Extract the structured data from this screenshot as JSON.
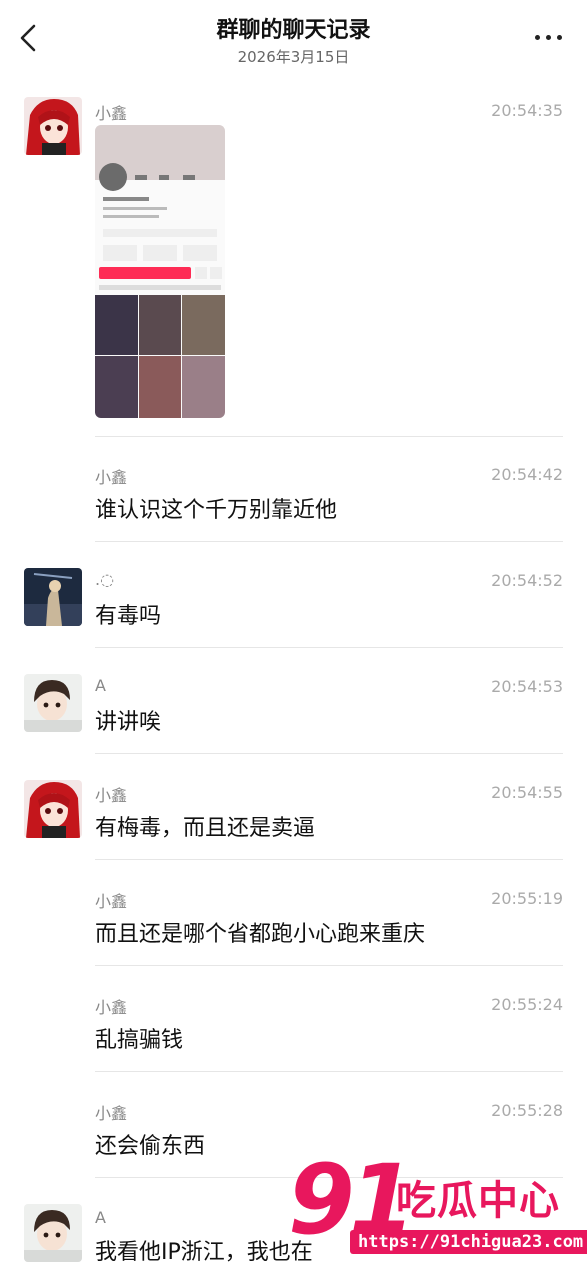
{
  "header": {
    "title": "群聊的聊天记录",
    "date": "2026年3月15日",
    "back_icon": "chevron-left-icon",
    "more_icon": "more-dots-icon"
  },
  "messages": [
    {
      "sender": "小鑫",
      "time": "20:54:35",
      "type": "image",
      "avatar": "red-hair-anime-girl"
    },
    {
      "sender": "小鑫",
      "time": "20:54:42",
      "text": "谁认识这个千万别靠近他"
    },
    {
      "sender": ".◌",
      "time": "20:54:52",
      "text": "有毒吗",
      "avatar": "photo-person-night"
    },
    {
      "sender": "A",
      "time": "20:54:53",
      "text": "讲讲唉",
      "avatar": "anime-boy"
    },
    {
      "sender": "小鑫",
      "time": "20:54:55",
      "text": "有梅毒，而且还是卖逼",
      "avatar": "red-hair-anime-girl"
    },
    {
      "sender": "小鑫",
      "time": "20:55:19",
      "text": "而且还是哪个省都跑小心跑来重庆"
    },
    {
      "sender": "小鑫",
      "time": "20:55:24",
      "text": "乱搞骗钱"
    },
    {
      "sender": "小鑫",
      "time": "20:55:28",
      "text": "还会偷东西"
    },
    {
      "sender": "A",
      "time": "",
      "text": "我看他IP浙江，我也在",
      "avatar": "anime-boy"
    }
  ],
  "watermark": {
    "number": "91",
    "brand": "吃瓜中心",
    "url": "https://91chigua23.com"
  },
  "colors": {
    "watermark": "#e8175d",
    "time": "#aaaaaa",
    "sender": "#888888"
  }
}
